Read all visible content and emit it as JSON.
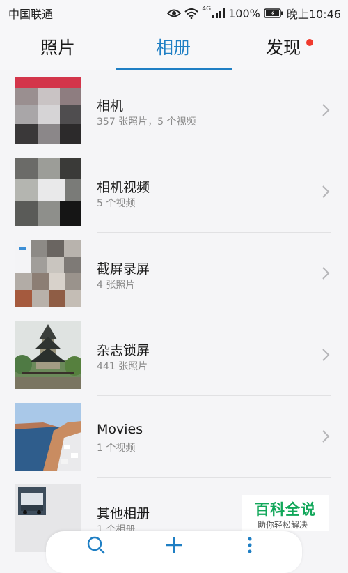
{
  "status_bar": {
    "carrier": "中国联通",
    "network": "4G",
    "battery": "100%",
    "time": "晚上10:46"
  },
  "tabs": [
    {
      "label": "照片",
      "active": false
    },
    {
      "label": "相册",
      "active": true
    },
    {
      "label": "发现",
      "active": false,
      "has_badge": true
    }
  ],
  "albums": [
    {
      "title": "相机",
      "subtitle": "357 张照片，5 个视频"
    },
    {
      "title": "相机视频",
      "subtitle": "5 个视频"
    },
    {
      "title": "截屏录屏",
      "subtitle": "4 张照片"
    },
    {
      "title": "杂志锁屏",
      "subtitle": "441 张照片"
    },
    {
      "title": "Movies",
      "subtitle": "1 个视频"
    },
    {
      "title": "其他相册",
      "subtitle": "1 个相册"
    }
  ],
  "toolbar": {
    "icons": [
      "search-icon",
      "plus-icon",
      "more-vertical-icon"
    ]
  },
  "watermark": {
    "title": "百科全说",
    "subtitle": "助你轻松解决"
  },
  "colors": {
    "accent": "#1f7fc4",
    "badge": "#f03a2e",
    "watermark_green": "#12a75a"
  }
}
